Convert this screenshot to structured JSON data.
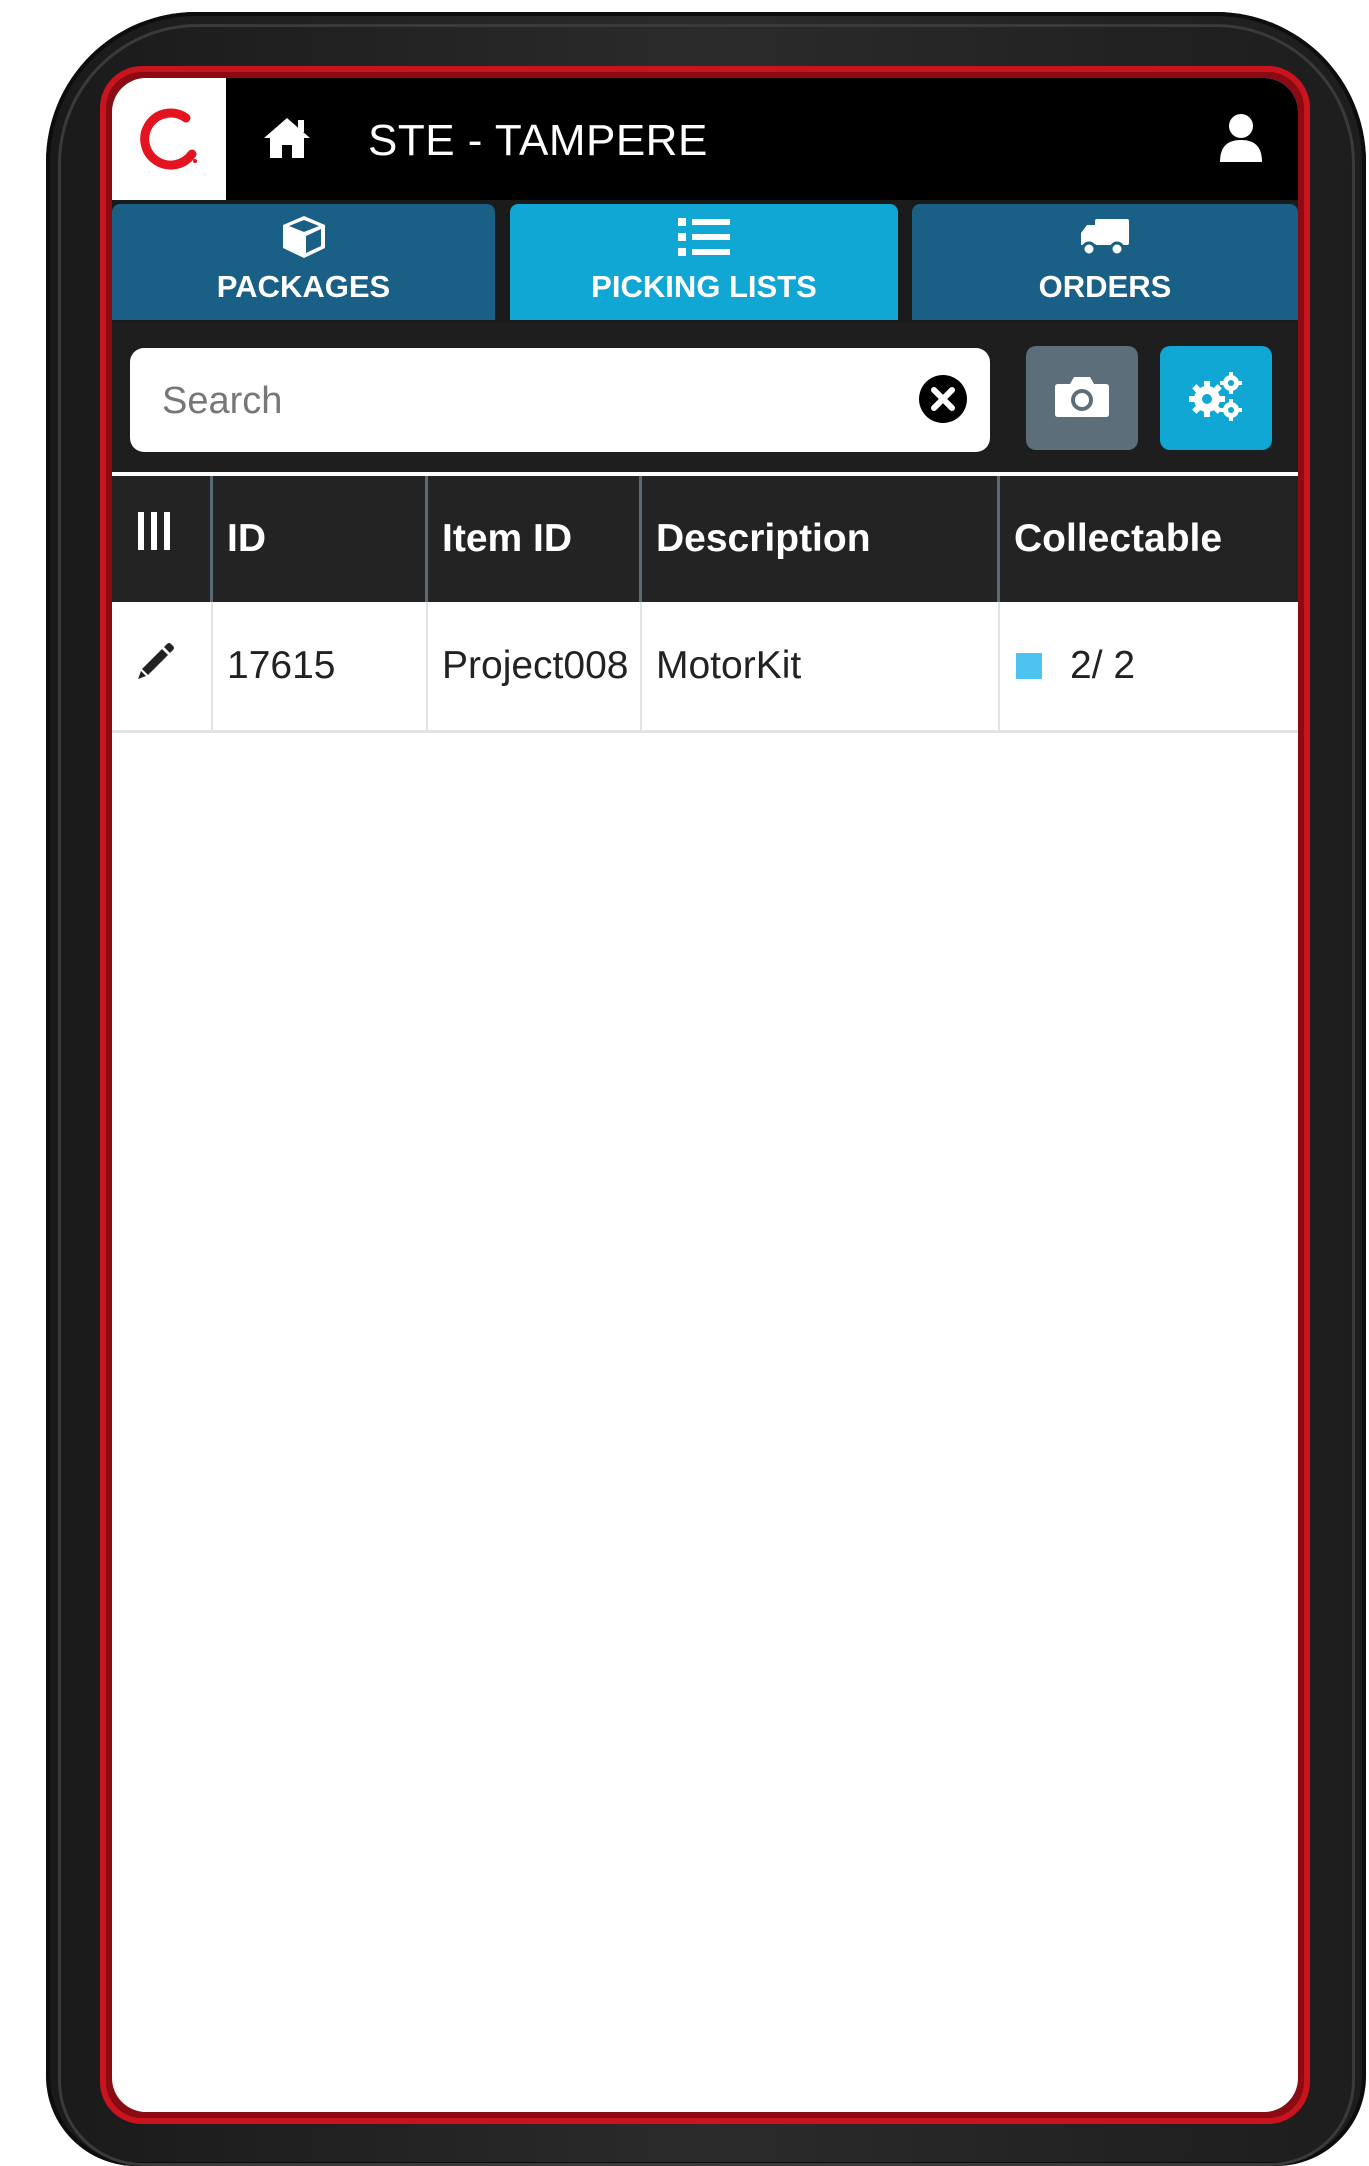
{
  "header": {
    "title": "STE - TAMPERE",
    "icons": {
      "logo": "brand-logo",
      "home": "home-icon",
      "user": "user-icon"
    }
  },
  "tabs": [
    {
      "label": "PACKAGES",
      "icon": "cube-icon",
      "active": false
    },
    {
      "label": "PICKING LISTS",
      "icon": "list-icon",
      "active": true
    },
    {
      "label": "ORDERS",
      "icon": "truck-icon",
      "active": false
    }
  ],
  "search": {
    "placeholder": "Search",
    "value": ""
  },
  "table": {
    "columns": [
      "ID",
      "Item ID",
      "Description",
      "Collectable"
    ],
    "rows": [
      {
        "id": "17615",
        "item_id": "Project008",
        "description": "MotorKit",
        "collectable": "2/ 2"
      }
    ]
  },
  "colors": {
    "brand_red": "#c9141f",
    "tab_blue": "#1a5f86",
    "tab_active": "#10a7d4",
    "status_square": "#4dc3f0"
  }
}
